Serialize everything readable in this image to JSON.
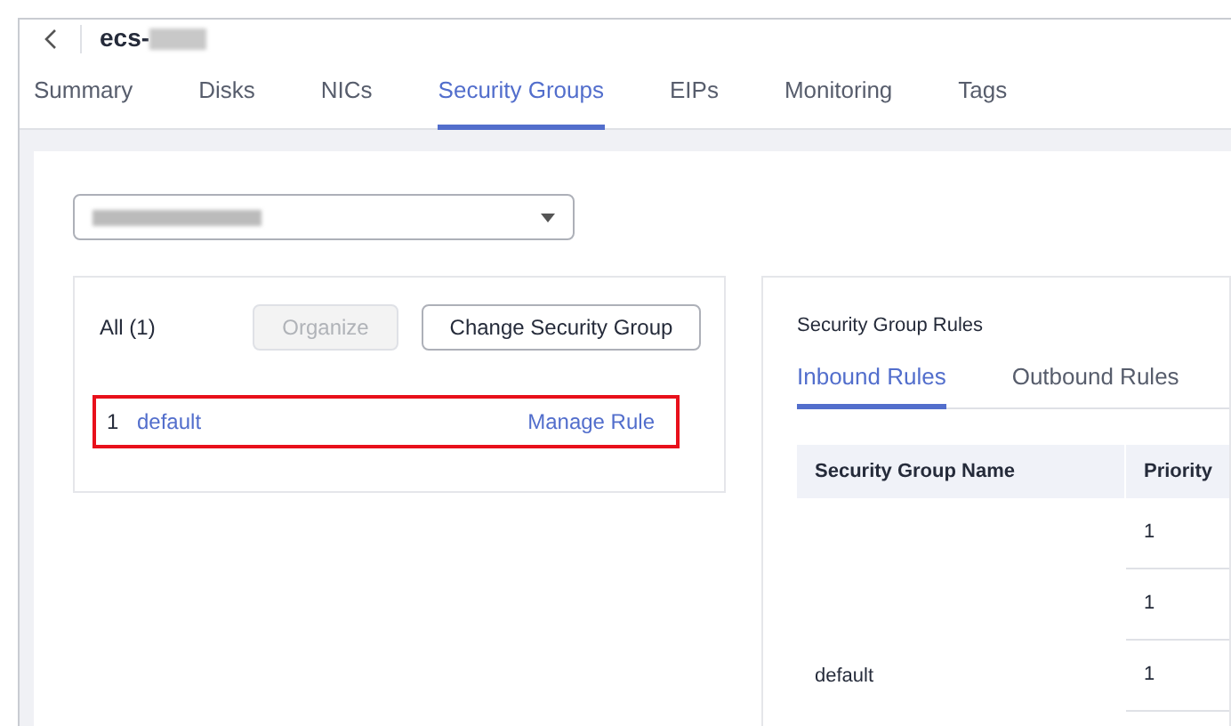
{
  "header": {
    "title": "ecs-"
  },
  "tabs": [
    {
      "label": "Summary",
      "selected": false
    },
    {
      "label": "Disks",
      "selected": false
    },
    {
      "label": "NICs",
      "selected": false
    },
    {
      "label": "Security Groups",
      "selected": true
    },
    {
      "label": "EIPs",
      "selected": false
    },
    {
      "label": "Monitoring",
      "selected": false
    },
    {
      "label": "Tags",
      "selected": false
    }
  ],
  "security_groups": {
    "count_label": "All (1)",
    "buttons": [
      {
        "label": "Organize",
        "disabled": true
      },
      {
        "label": "Change Security Group",
        "disabled": false
      }
    ],
    "items": [
      {
        "index": "1",
        "name": "default",
        "action": "Manage Rule",
        "selected": true
      }
    ]
  },
  "rules": {
    "title": "Security Group Rules",
    "tabs": [
      {
        "label": "Inbound Rules",
        "selected": true
      },
      {
        "label": "Outbound Rules",
        "selected": false
      }
    ],
    "columns": [
      "Security Group Name",
      "Priority"
    ],
    "rows": [
      {
        "priority": "1"
      },
      {
        "priority": "1"
      },
      {
        "name": "default",
        "priority": "1"
      }
    ]
  }
}
